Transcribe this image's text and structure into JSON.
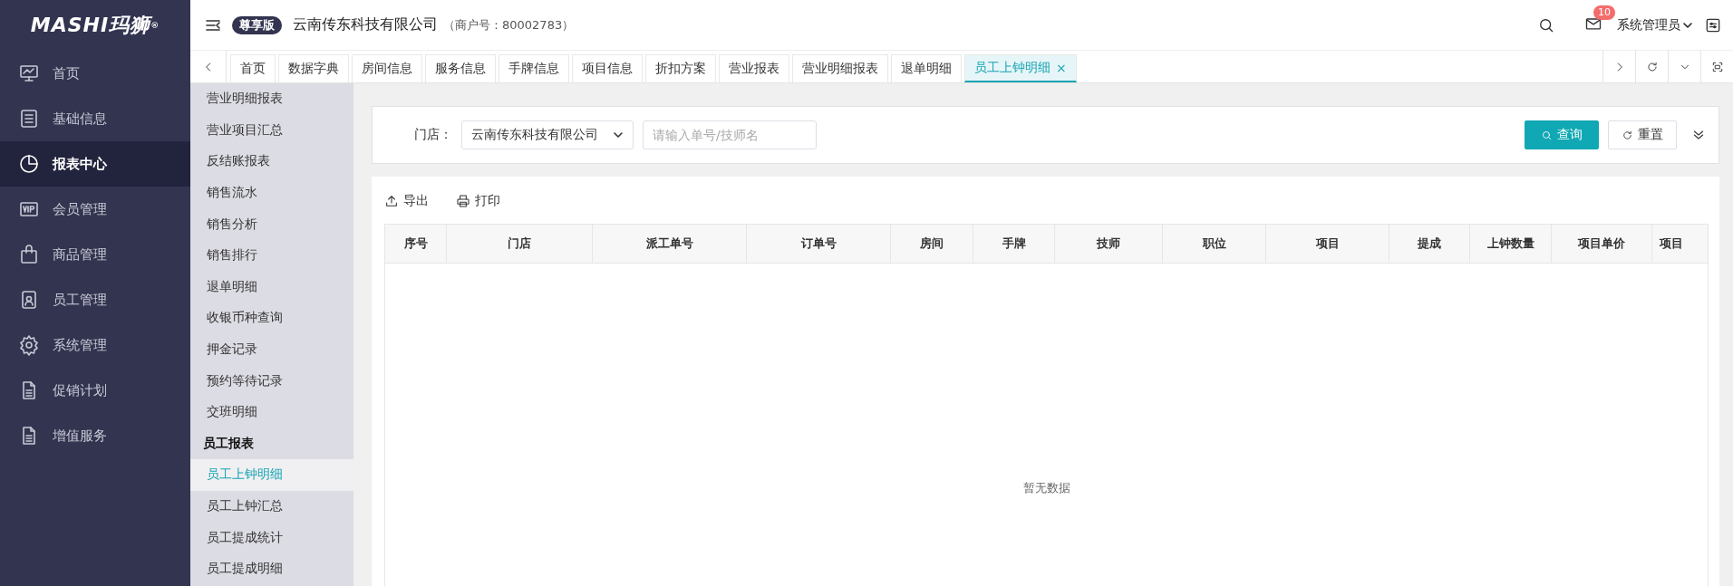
{
  "logo": {
    "text": "MASHI玛狮",
    "mark": "®"
  },
  "header": {
    "edition": "尊享版",
    "company": "云南传东科技有限公司",
    "merchant": "（商户号：80002783）",
    "mail_count": "10",
    "user": "系统管理员"
  },
  "tabs": [
    {
      "label": "首页",
      "selected": false
    },
    {
      "label": "数据字典",
      "selected": false
    },
    {
      "label": "房间信息",
      "selected": false
    },
    {
      "label": "服务信息",
      "selected": false
    },
    {
      "label": "手牌信息",
      "selected": false
    },
    {
      "label": "项目信息",
      "selected": false
    },
    {
      "label": "折扣方案",
      "selected": false
    },
    {
      "label": "营业报表",
      "selected": false
    },
    {
      "label": "营业明细报表",
      "selected": false
    },
    {
      "label": "退单明细",
      "selected": false
    },
    {
      "label": "员工上钟明细",
      "selected": true,
      "close": "×"
    }
  ],
  "sidebar": {
    "items": [
      {
        "label": "首页",
        "selected": false
      },
      {
        "label": "基础信息",
        "selected": false
      },
      {
        "label": "报表中心",
        "selected": true
      },
      {
        "label": "会员管理",
        "selected": false
      },
      {
        "label": "商品管理",
        "selected": false
      },
      {
        "label": "员工管理",
        "selected": false
      },
      {
        "label": "系统管理",
        "selected": false
      },
      {
        "label": "促销计划",
        "selected": false
      },
      {
        "label": "增值服务",
        "selected": false
      }
    ]
  },
  "submenu": {
    "items": [
      {
        "kind": "item",
        "label": "营业明细报表",
        "selected": false
      },
      {
        "kind": "item",
        "label": "营业项目汇总",
        "selected": false
      },
      {
        "kind": "item",
        "label": "反结账报表",
        "selected": false
      },
      {
        "kind": "item",
        "label": "销售流水",
        "selected": false
      },
      {
        "kind": "item",
        "label": "销售分析",
        "selected": false
      },
      {
        "kind": "item",
        "label": "销售排行",
        "selected": false
      },
      {
        "kind": "item",
        "label": "退单明细",
        "selected": false
      },
      {
        "kind": "item",
        "label": "收银币种查询",
        "selected": false
      },
      {
        "kind": "item",
        "label": "押金记录",
        "selected": false
      },
      {
        "kind": "item",
        "label": "预约等待记录",
        "selected": false
      },
      {
        "kind": "item",
        "label": "交班明细",
        "selected": false
      },
      {
        "kind": "group",
        "label": "员工报表"
      },
      {
        "kind": "item",
        "label": "员工上钟明细",
        "selected": true
      },
      {
        "kind": "item",
        "label": "员工上钟汇总",
        "selected": false
      },
      {
        "kind": "item",
        "label": "员工提成统计",
        "selected": false
      },
      {
        "kind": "item",
        "label": "员工提成明细",
        "selected": false
      }
    ]
  },
  "filter": {
    "store_label": "门店：",
    "store_value": "云南传东科技有限公司",
    "search_placeholder": "请输入单号/技师名",
    "query_button": "查询",
    "reset_button": "重置"
  },
  "toolbar": {
    "export": "导出",
    "print": "打印"
  },
  "table": {
    "columns": [
      "序号",
      "门店",
      "派工单号",
      "订单号",
      "房间",
      "手牌",
      "技师",
      "职位",
      "项目",
      "提成",
      "上钟数量",
      "项目单价",
      "项目"
    ],
    "empty_text": "暂无数据"
  }
}
